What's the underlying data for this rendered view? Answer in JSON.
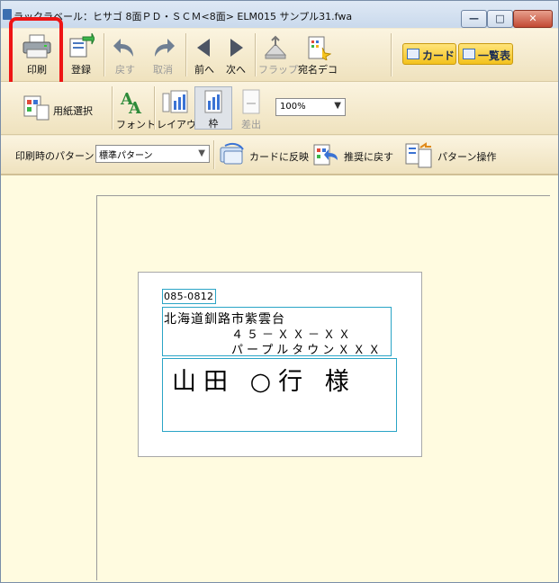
{
  "window": {
    "title": "ラックラベール：ヒサゴ 8面ＰＤ・ＳＣＭ<8面> ELM015  サンプル31.fwa",
    "min_label": "—",
    "max_label": "□",
    "close_label": "✕"
  },
  "toolbar1": {
    "print": "印刷",
    "register": "登録",
    "undo": "戻す",
    "cancel": "取消",
    "prev": "前へ",
    "next": "次へ",
    "flap": "フラップ",
    "addr_deco": "宛名デコ",
    "card": "カード",
    "list": "一覧表"
  },
  "toolbar2": {
    "paper_select": "用紙選択",
    "font": "フォント",
    "layout": "レイアウト",
    "frame": "枠",
    "sender": "差出",
    "zoom": "100%"
  },
  "toolbar3": {
    "pattern_label": "印刷時のパターン",
    "pattern_value": "標準パターン",
    "reflect_card": "カードに反映",
    "restore_recommended": "推奨に戻す",
    "pattern_ops": "パターン操作"
  },
  "card": {
    "zip": "085-0812",
    "address1": "北海道釧路市紫雲台",
    "address2": "４５－ＸＸ－ＸＸ",
    "address3": "パープルタウンＸＸＸ",
    "name": "山田 ○行 様"
  },
  "colors": {
    "highlight": "#ee1414",
    "frame_border": "#2aa4c6",
    "view_button": "#f3c21d"
  }
}
